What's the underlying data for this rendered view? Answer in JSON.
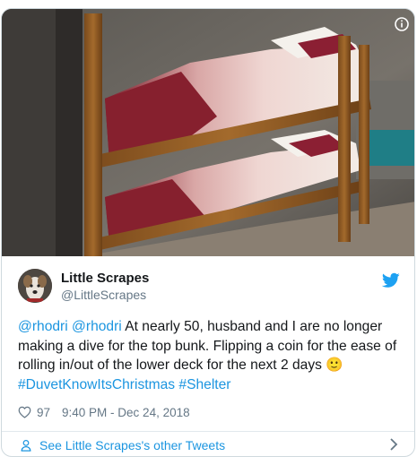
{
  "tweet": {
    "display_name": "Little Scrapes",
    "handle": "@LittleScrapes",
    "mentions": [
      "@rhodri",
      "@rhodri"
    ],
    "body_text": "At nearly 50, husband and I are no longer making a dive for the top bunk. Flipping a coin for the ease of rolling in/out of the lower deck for the next 2 days 🙂",
    "hashtags": [
      "#DuvetKnowItsChristmas",
      "#Shelter"
    ],
    "like_count": "97",
    "timestamp": "9:40 PM - Dec 24, 2018"
  },
  "footer": {
    "see_more_label": "See Little Scrapes's other Tweets"
  },
  "icons": {
    "info": "info-icon",
    "bird": "twitter-bird-icon",
    "heart": "heart-icon",
    "person": "person-icon",
    "chevron": "chevron-right-icon"
  },
  "colors": {
    "link": "#1b95e0",
    "muted": "#657786",
    "bird": "#1da1f2",
    "border": "#cfd9de"
  }
}
